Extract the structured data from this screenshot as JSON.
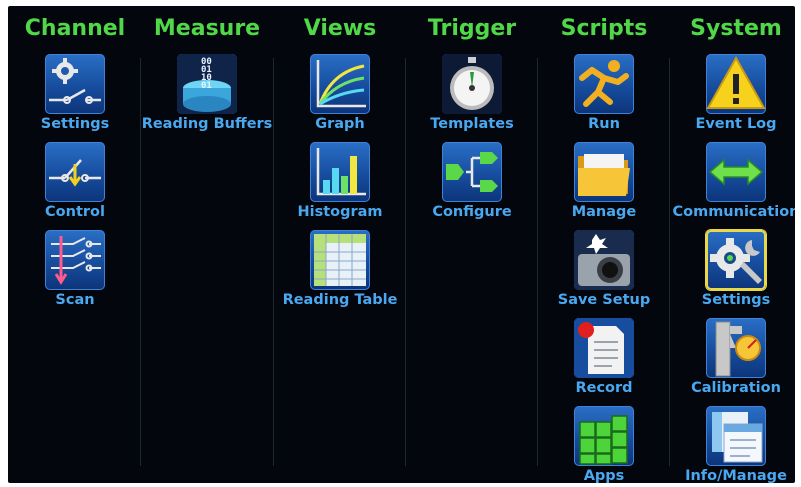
{
  "menu": {
    "columns": [
      {
        "title": "Channel",
        "items": [
          {
            "label": "Settings",
            "icon": "channel-settings-icon"
          },
          {
            "label": "Control",
            "icon": "channel-control-icon"
          },
          {
            "label": "Scan",
            "icon": "scan-icon"
          }
        ]
      },
      {
        "title": "Measure",
        "items": [
          {
            "label": "Reading Buffers",
            "icon": "reading-buffers-icon"
          }
        ]
      },
      {
        "title": "Views",
        "items": [
          {
            "label": "Graph",
            "icon": "graph-icon"
          },
          {
            "label": "Histogram",
            "icon": "histogram-icon"
          },
          {
            "label": "Reading Table",
            "icon": "reading-table-icon"
          }
        ]
      },
      {
        "title": "Trigger",
        "items": [
          {
            "label": "Templates",
            "icon": "stopwatch-icon"
          },
          {
            "label": "Configure",
            "icon": "trigger-configure-icon"
          }
        ]
      },
      {
        "title": "Scripts",
        "items": [
          {
            "label": "Run",
            "icon": "run-icon"
          },
          {
            "label": "Manage",
            "icon": "folder-icon"
          },
          {
            "label": "Save Setup",
            "icon": "camera-icon"
          },
          {
            "label": "Record",
            "icon": "record-icon"
          },
          {
            "label": "Apps",
            "icon": "apps-icon"
          }
        ]
      },
      {
        "title": "System",
        "items": [
          {
            "label": "Event Log",
            "icon": "warning-icon"
          },
          {
            "label": "Communication",
            "icon": "communication-icon"
          },
          {
            "label": "Settings",
            "icon": "system-settings-icon",
            "selected": true
          },
          {
            "label": "Calibration",
            "icon": "calibration-icon"
          },
          {
            "label": "Info/Manage",
            "icon": "info-manage-icon"
          }
        ]
      }
    ]
  },
  "colors": {
    "background": "#03060c",
    "heading": "#50d848",
    "label": "#4aa8f0",
    "tile": "#1d5aad",
    "selection": "#e8d84a"
  }
}
